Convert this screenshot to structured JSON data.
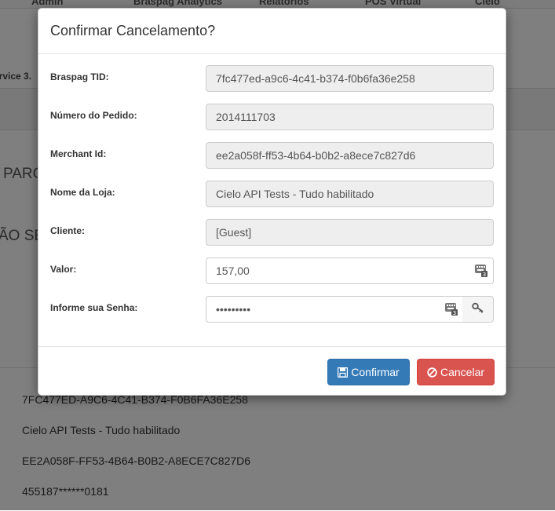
{
  "background": {
    "nav": [
      "Admin",
      "Braspag Analytics",
      "Relatórios",
      "POS Virtual",
      "Cielo"
    ],
    "subbar_text": "ervice 3.",
    "heading_1": "PARC",
    "heading_2": "ÃO SE",
    "lines": [
      "7FC477ED-A9C6-4C41-B374-F0B6FA36E258",
      "Cielo API Tests - Tudo habilitado",
      "EE2A058F-FF53-4B64-B0B2-A8ECE7C827D6",
      "455187******0181"
    ]
  },
  "modal": {
    "title": "Confirmar Cancelamento?",
    "fields": {
      "braspag_tid": {
        "label": "Braspag TID:",
        "value": "7fc477ed-a9c6-4c41-b374-f0b6fa36e258"
      },
      "numero_pedido": {
        "label": "Número do Pedido:",
        "value": "2014111703"
      },
      "merchant_id": {
        "label": "Merchant Id:",
        "value": "ee2a058f-ff53-4b64-b0b2-a8ece7c827d6"
      },
      "nome_loja": {
        "label": "Nome da Loja:",
        "value": "Cielo API Tests - Tudo habilitado"
      },
      "cliente": {
        "label": "Cliente:",
        "value": "[Guest]"
      },
      "valor": {
        "label": "Valor:",
        "value": "157,00"
      },
      "senha": {
        "label": "Informe sua Senha:",
        "value": "•••••••••"
      }
    },
    "buttons": {
      "confirm": "Confirmar",
      "cancel": "Cancelar"
    }
  },
  "colors": {
    "primary": "#337ab7",
    "danger": "#d9534f",
    "readonly_bg": "#eeeeee"
  },
  "icons": [
    "keyboard-icon",
    "key-icon",
    "save-icon",
    "ban-icon"
  ]
}
